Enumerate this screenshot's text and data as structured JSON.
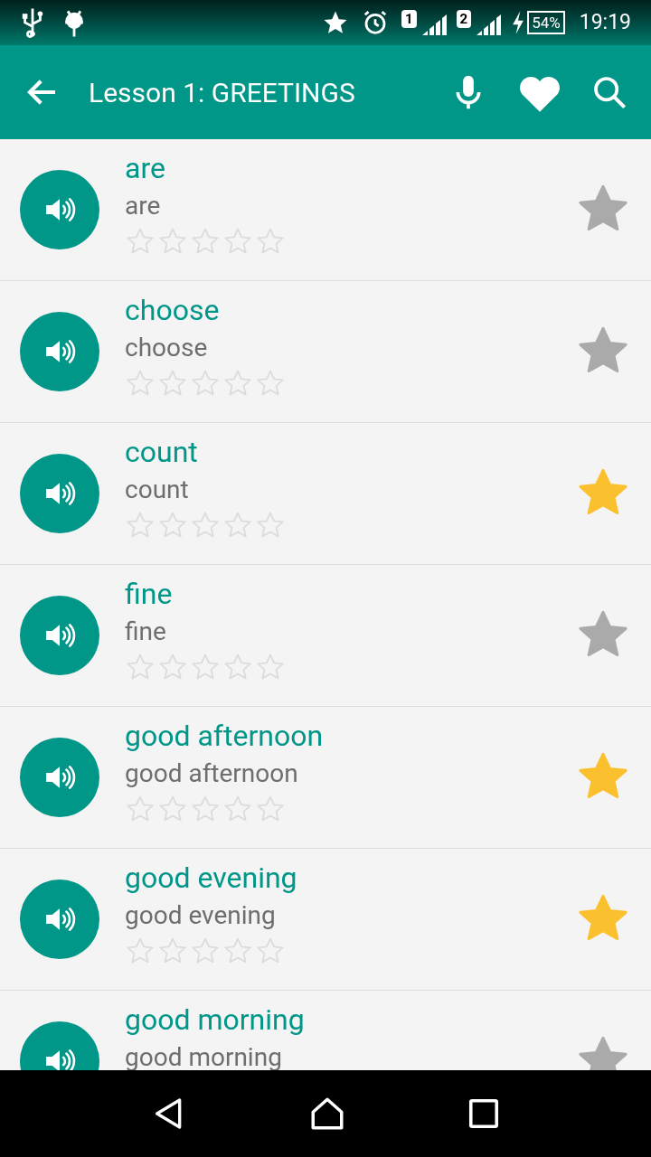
{
  "status_bar": {
    "sim_1": "1",
    "sim_2": "2",
    "battery": "54%",
    "time": "19:19"
  },
  "toolbar": {
    "title": "Lesson 1: GREETINGS"
  },
  "words": [
    {
      "word": "are",
      "translation": "are",
      "stars": 0,
      "favorite": false
    },
    {
      "word": "choose",
      "translation": "choose",
      "stars": 0,
      "favorite": false
    },
    {
      "word": "count",
      "translation": "count",
      "stars": 0,
      "favorite": true
    },
    {
      "word": "fine",
      "translation": "fine",
      "stars": 0,
      "favorite": false
    },
    {
      "word": "good afternoon",
      "translation": "good afternoon",
      "stars": 0,
      "favorite": true
    },
    {
      "word": "good evening",
      "translation": "good evening",
      "stars": 0,
      "favorite": true
    },
    {
      "word": "good morning",
      "translation": "good morning",
      "favorite": false
    }
  ]
}
